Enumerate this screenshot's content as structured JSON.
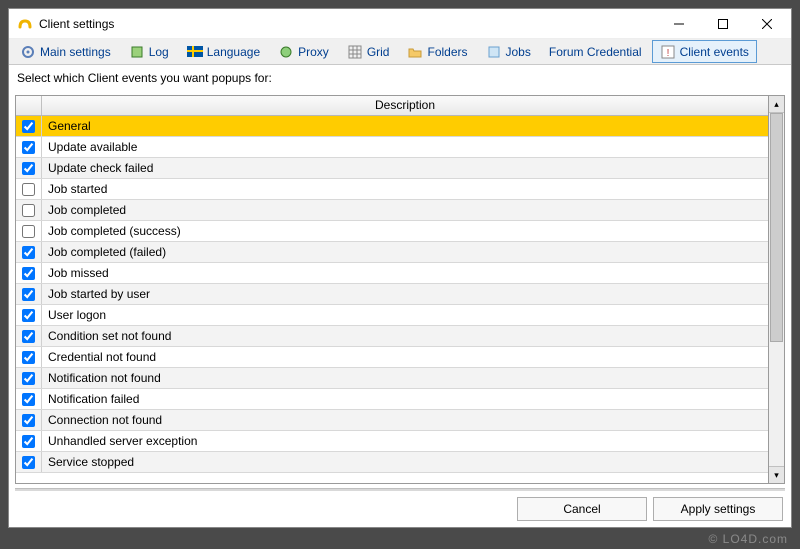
{
  "window": {
    "title": "Client settings"
  },
  "toolbar": {
    "items": [
      {
        "label": "Main settings"
      },
      {
        "label": "Log"
      },
      {
        "label": "Language"
      },
      {
        "label": "Proxy"
      },
      {
        "label": "Grid"
      },
      {
        "label": "Folders"
      },
      {
        "label": "Jobs"
      },
      {
        "label": "Forum Credential"
      },
      {
        "label": "Client events"
      }
    ],
    "active_index": 8
  },
  "instruction": "Select which Client events you want popups for:",
  "grid": {
    "header": {
      "description": "Description"
    },
    "rows": [
      {
        "checked": true,
        "label": "General",
        "selected": true
      },
      {
        "checked": true,
        "label": "Update available"
      },
      {
        "checked": true,
        "label": "Update check failed"
      },
      {
        "checked": false,
        "label": "Job started"
      },
      {
        "checked": false,
        "label": "Job completed"
      },
      {
        "checked": false,
        "label": "Job completed (success)"
      },
      {
        "checked": true,
        "label": "Job completed (failed)"
      },
      {
        "checked": true,
        "label": "Job missed"
      },
      {
        "checked": true,
        "label": "Job started by user"
      },
      {
        "checked": true,
        "label": "User logon"
      },
      {
        "checked": true,
        "label": "Condition set not found"
      },
      {
        "checked": true,
        "label": "Credential not found"
      },
      {
        "checked": true,
        "label": "Notification not found"
      },
      {
        "checked": true,
        "label": "Notification failed"
      },
      {
        "checked": true,
        "label": "Connection not found"
      },
      {
        "checked": true,
        "label": "Unhandled server exception"
      },
      {
        "checked": true,
        "label": "Service stopped"
      }
    ]
  },
  "buttons": {
    "cancel": "Cancel",
    "apply": "Apply settings"
  },
  "watermark": "© LO4D.com"
}
